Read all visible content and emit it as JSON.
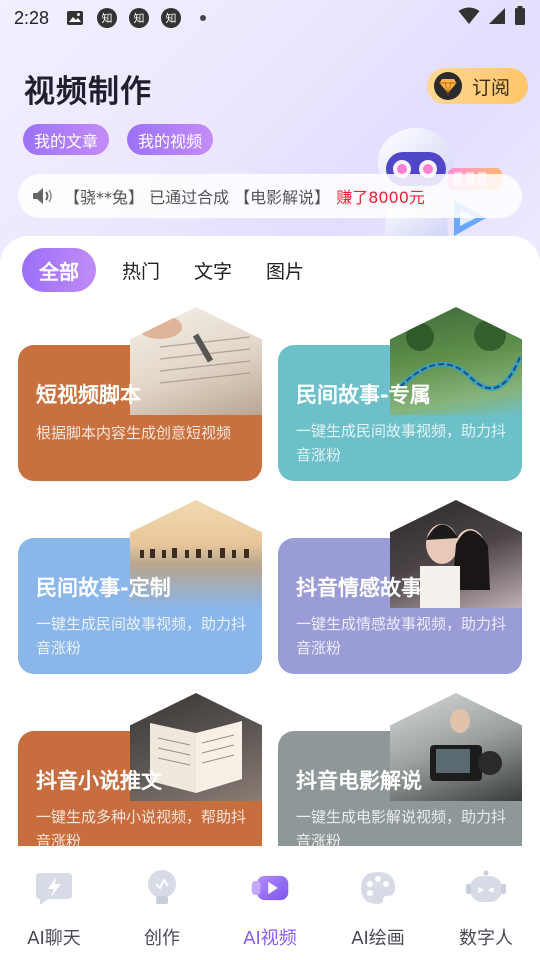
{
  "status_bar": {
    "time": "2:28",
    "app_badge": "知"
  },
  "header": {
    "title": "视频制作",
    "subscribe_label": "订阅"
  },
  "pills": [
    {
      "label": "我的文章"
    },
    {
      "label": "我的视频"
    }
  ],
  "ticker": {
    "prefix": "【骁**兔】 已通过合成 【电影解说】",
    "highlight": "赚了8000元",
    "highlight_color": "#ee2233"
  },
  "tabs": [
    {
      "label": "全部",
      "active": true
    },
    {
      "label": "热门"
    },
    {
      "label": "文字"
    },
    {
      "label": "图片"
    }
  ],
  "cards": [
    {
      "title": "短视频脚本",
      "desc": "根据脚本内容生成创意短视频",
      "color": "#c8703e",
      "photo": "handwriting-notes"
    },
    {
      "title": "民间故事-专属",
      "desc": "一键生成民间故事视频，助力抖音涨粉",
      "color": "#6cc0c9",
      "photo": "mountain-train"
    },
    {
      "title": "民间故事-定制",
      "desc": "一键生成民间故事视频，助力抖音涨粉",
      "color": "#8ab6ea",
      "photo": "savanna-herd"
    },
    {
      "title": "抖音情感故事",
      "desc": "一键生成情感故事视频，助力抖音涨粉",
      "color": "#9a9cd8",
      "photo": "couple"
    },
    {
      "title": "抖音小说推文",
      "desc": "一键生成多种小说视频，帮助抖音涨粉",
      "color": "#c76d3e",
      "photo": "open-book"
    },
    {
      "title": "抖音电影解说",
      "desc": "一键生成电影解说视频，助力抖音涨粉",
      "color": "#8e9898",
      "photo": "film-camera"
    }
  ],
  "bottom_nav": [
    {
      "label": "AI聊天",
      "icon": "lightning-chat-icon"
    },
    {
      "label": "创作",
      "icon": "lightbulb-icon"
    },
    {
      "label": "AI视频",
      "icon": "video-play-icon",
      "active": true
    },
    {
      "label": "AI绘画",
      "icon": "palette-icon"
    },
    {
      "label": "数字人",
      "icon": "robot-face-icon"
    }
  ],
  "colors": {
    "accent": "#8a5cf0",
    "pill_gradient": [
      "#9b72f6",
      "#c48cf7"
    ],
    "subscribe_gradient": [
      "#ffd892",
      "#ffc56a"
    ]
  }
}
